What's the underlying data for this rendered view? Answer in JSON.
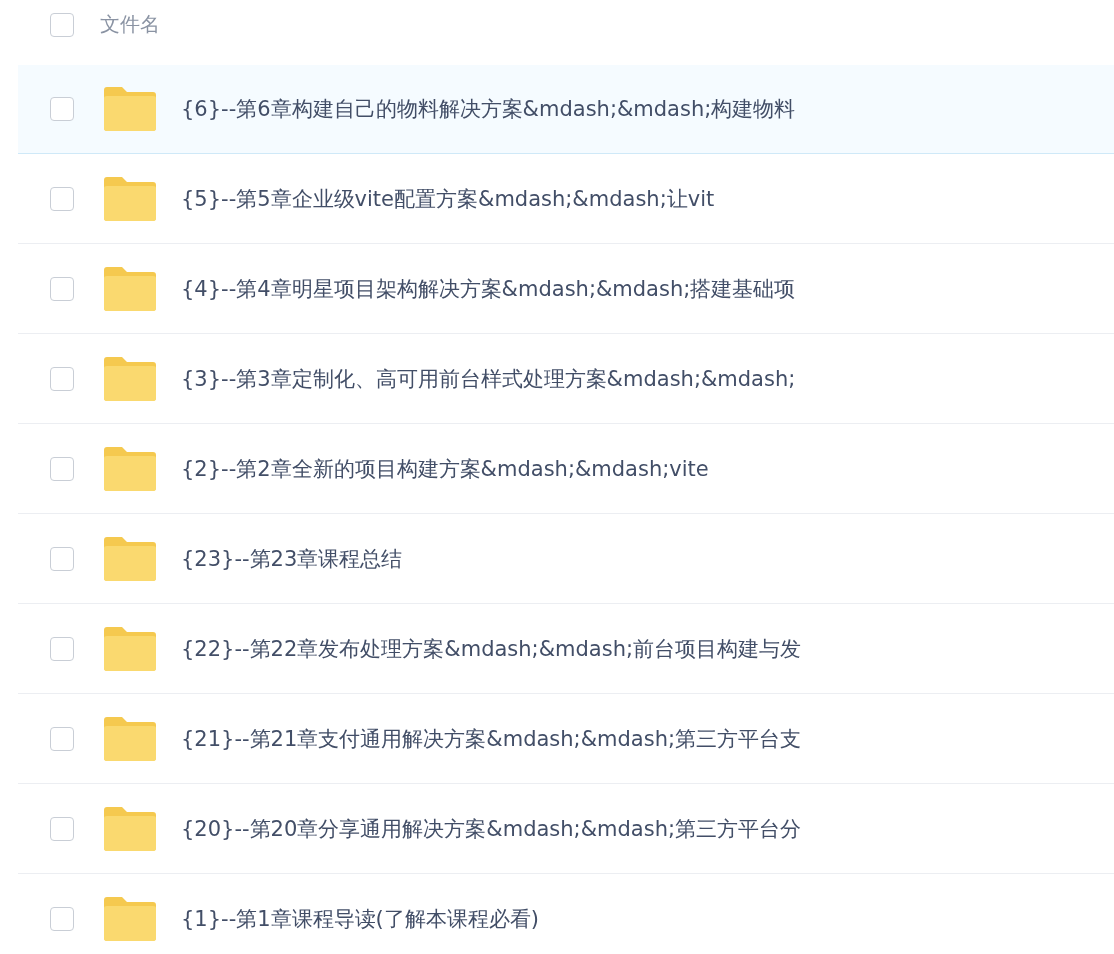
{
  "header": {
    "checked": false,
    "label": "文件名"
  },
  "rows": [
    {
      "name": "{6}--第6章构建自己的物料解决方案&mdash;&mdash;构建物料",
      "checked": false,
      "highlighted": true
    },
    {
      "name": "{5}--第5章企业级vite配置方案&mdash;&mdash;让vit",
      "checked": false,
      "highlighted": false
    },
    {
      "name": "{4}--第4章明星项目架构解决方案&mdash;&mdash;搭建基础项",
      "checked": false,
      "highlighted": false
    },
    {
      "name": "{3}--第3章定制化、高可用前台样式处理方案&mdash;&mdash;",
      "checked": false,
      "highlighted": false
    },
    {
      "name": "{2}--第2章全新的项目构建方案&mdash;&mdash;vite",
      "checked": false,
      "highlighted": false
    },
    {
      "name": "{23}--第23章课程总结",
      "checked": false,
      "highlighted": false
    },
    {
      "name": "{22}--第22章发布处理方案&mdash;&mdash;前台项目构建与发",
      "checked": false,
      "highlighted": false
    },
    {
      "name": "{21}--第21章支付通用解决方案&mdash;&mdash;第三方平台支",
      "checked": false,
      "highlighted": false
    },
    {
      "name": "{20}--第20章分享通用解决方案&mdash;&mdash;第三方平台分",
      "checked": false,
      "highlighted": false
    },
    {
      "name": "{1}--第1章课程导读(了解本课程必看)",
      "checked": false,
      "highlighted": false
    }
  ]
}
